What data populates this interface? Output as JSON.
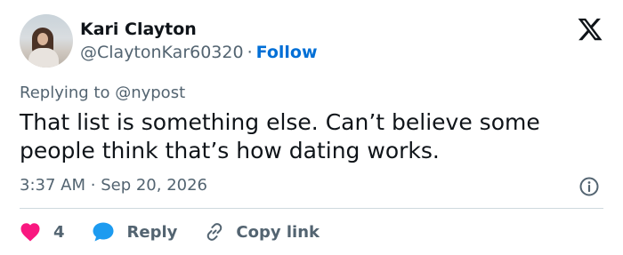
{
  "author": {
    "name": "Kari Clayton",
    "handle": "@ClaytonKar60320",
    "separator": "·",
    "follow_label": "Follow"
  },
  "tweet": {
    "replying_to": "Replying to @nypost",
    "text": "That list is something else. Can’t believe some people think that’s how dating works.",
    "time": "3:37 AM",
    "separator": "·",
    "date": "Sep 20, 2026"
  },
  "actions": {
    "like_count": "4",
    "reply_label": "Reply",
    "copy_link_label": "Copy link"
  },
  "icons": {
    "brand": "x-logo-icon",
    "info": "info-icon",
    "like": "heart-icon",
    "reply": "speech-bubble-icon",
    "copy": "link-icon"
  },
  "colors": {
    "text": "#0f1419",
    "secondary": "#536471",
    "follow": "#006fd6",
    "heart": "#f91880",
    "reply_bubble": "#1d9bf0",
    "divider": "#cfd9de"
  }
}
